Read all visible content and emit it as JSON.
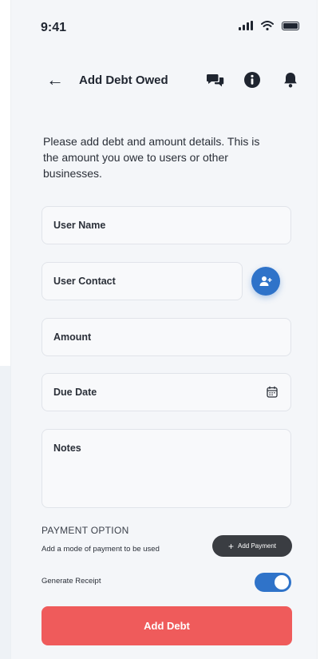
{
  "status_bar": {
    "time": "9:41"
  },
  "header": {
    "title": "Add Debt Owed"
  },
  "intro_text": "Please add debt and amount details. This is the amount you owe to users or other businesses.",
  "form": {
    "user_name": {
      "placeholder": "User Name"
    },
    "user_contact": {
      "placeholder": "User Contact"
    },
    "amount": {
      "placeholder": "Amount"
    },
    "due_date": {
      "placeholder": "Due Date"
    },
    "notes": {
      "placeholder": "Notes"
    }
  },
  "payment": {
    "title": "PAYMENT OPTION",
    "subtitle": "Add a mode of payment to be used",
    "add_label": "Add Payment",
    "add_symbol": "+"
  },
  "receipt": {
    "label": "Generate Receipt",
    "enabled": true
  },
  "submit_label": "Add Debt",
  "colors": {
    "accent": "#2f73c9",
    "danger": "#ef5b5b",
    "dark_button": "#3a3d42",
    "background": "#f4f6f9"
  },
  "icons": [
    "back-arrow-icon",
    "chat-icon",
    "info-icon",
    "bell-icon",
    "add-contact-icon",
    "calendar-icon",
    "plus-icon"
  ]
}
